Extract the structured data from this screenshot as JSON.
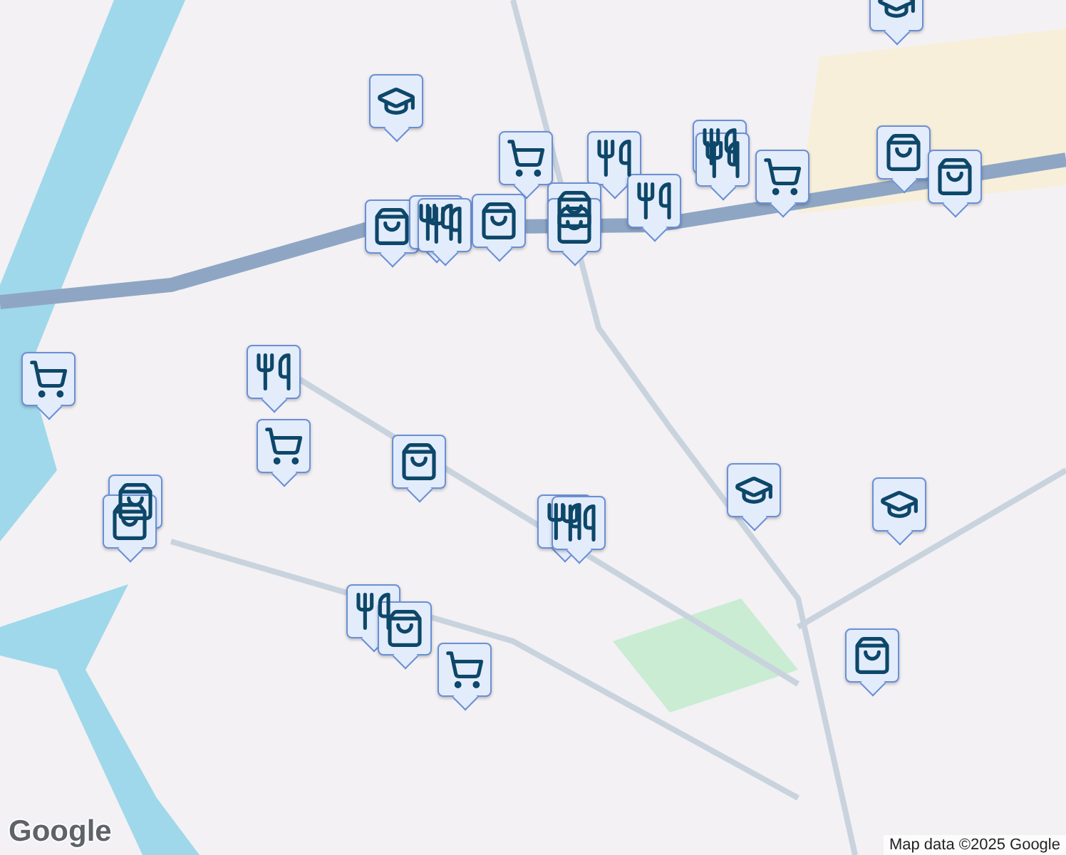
{
  "map": {
    "markers": [
      {
        "kind": "school"
      },
      {
        "kind": "school"
      },
      {
        "kind": "restaurant"
      },
      {
        "kind": "restaurant"
      },
      {
        "kind": "grocery"
      },
      {
        "kind": "shopping"
      },
      {
        "kind": "grocery"
      },
      {
        "kind": "restaurant"
      },
      {
        "kind": "restaurant"
      },
      {
        "kind": "shopping"
      },
      {
        "kind": "shopping"
      },
      {
        "kind": "shopping"
      },
      {
        "kind": "shopping"
      },
      {
        "kind": "restaurant"
      },
      {
        "kind": "restaurant"
      },
      {
        "kind": "shopping"
      },
      {
        "kind": "restaurant"
      },
      {
        "kind": "grocery"
      },
      {
        "kind": "grocery"
      },
      {
        "kind": "shopping"
      },
      {
        "kind": "shopping"
      },
      {
        "kind": "school"
      },
      {
        "kind": "school"
      },
      {
        "kind": "shopping"
      },
      {
        "kind": "restaurant"
      },
      {
        "kind": "restaurant"
      },
      {
        "kind": "restaurant"
      },
      {
        "kind": "shopping"
      },
      {
        "kind": "shopping"
      },
      {
        "kind": "grocery"
      }
    ]
  },
  "logo": "Google",
  "attribution": "Map data ©2025 Google"
}
